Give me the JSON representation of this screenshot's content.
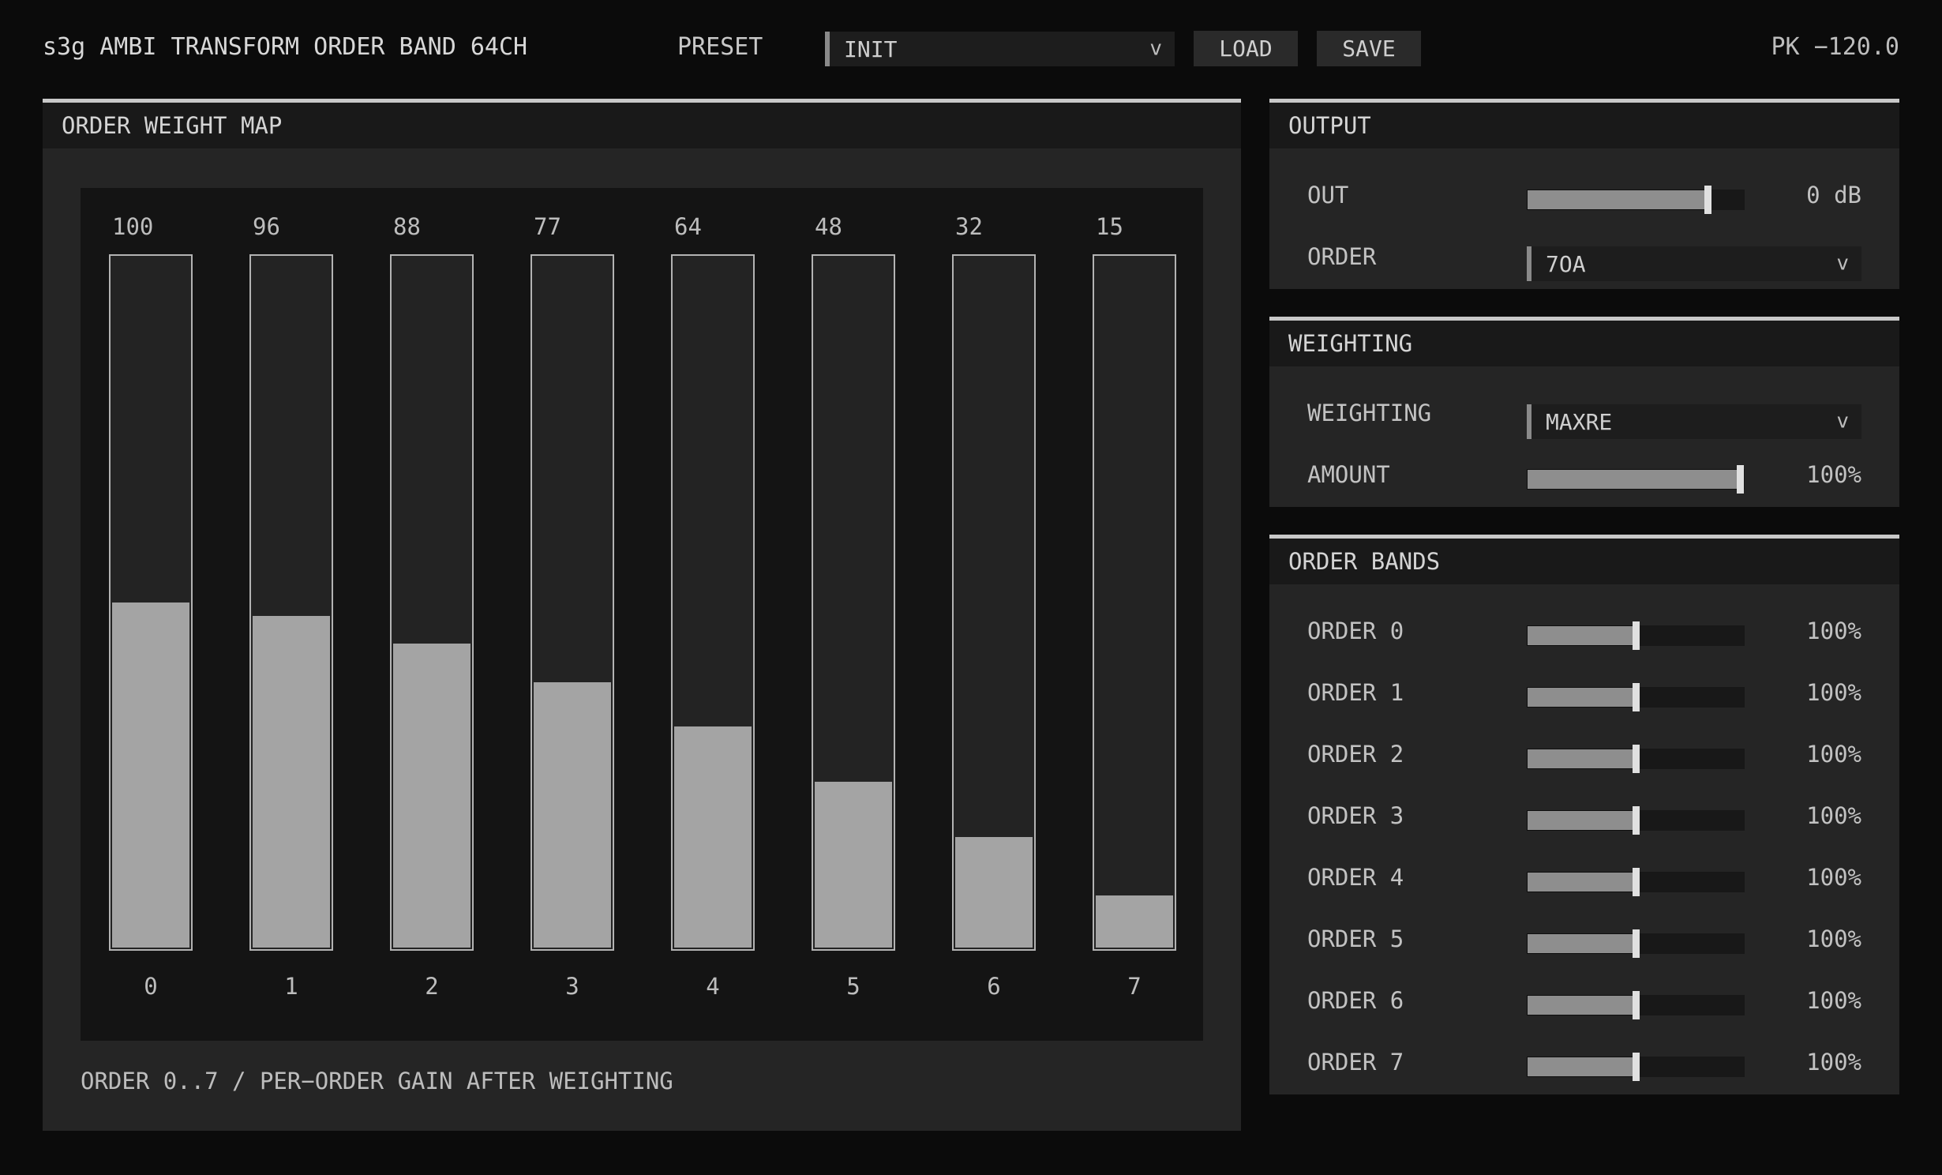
{
  "header": {
    "title": "s3g AMBI TRANSFORM ORDER BAND 64CH",
    "preset_label": "PRESET",
    "preset_value": "INIT",
    "load_label": "LOAD",
    "save_label": "SAVE",
    "peak": "PK −120.0"
  },
  "order_weight_map": {
    "title": "ORDER WEIGHT MAP",
    "footer": "ORDER 0..7 / PER−ORDER GAIN AFTER WEIGHTING"
  },
  "chart_data": {
    "type": "bar",
    "categories": [
      "0",
      "1",
      "2",
      "3",
      "4",
      "5",
      "6",
      "7"
    ],
    "values": [
      100,
      96,
      88,
      77,
      64,
      48,
      32,
      15
    ],
    "value_labels": [
      "100",
      "96",
      "88",
      "77",
      "64",
      "48",
      "32",
      "15"
    ],
    "ylim": [
      0,
      200
    ]
  },
  "output": {
    "title": "OUTPUT",
    "out_label": "OUT",
    "out_value": "0 dB",
    "out_level": 0.83,
    "order_label": "ORDER",
    "order_value": "7OA"
  },
  "weighting": {
    "title": "WEIGHTING",
    "weighting_label": "WEIGHTING",
    "weighting_value": "MAXRE",
    "amount_label": "AMOUNT",
    "amount_value": "100%",
    "amount_level": 0.98
  },
  "order_bands": {
    "title": "ORDER BANDS",
    "items": [
      {
        "label": "ORDER 0",
        "value": "100%",
        "level": 0.5
      },
      {
        "label": "ORDER 1",
        "value": "100%",
        "level": 0.5
      },
      {
        "label": "ORDER 2",
        "value": "100%",
        "level": 0.5
      },
      {
        "label": "ORDER 3",
        "value": "100%",
        "level": 0.5
      },
      {
        "label": "ORDER 4",
        "value": "100%",
        "level": 0.5
      },
      {
        "label": "ORDER 5",
        "value": "100%",
        "level": 0.5
      },
      {
        "label": "ORDER 6",
        "value": "100%",
        "level": 0.5
      },
      {
        "label": "ORDER 7",
        "value": "100%",
        "level": 0.5
      }
    ]
  },
  "icons": {
    "dropdown": "chevron-down-icon"
  }
}
